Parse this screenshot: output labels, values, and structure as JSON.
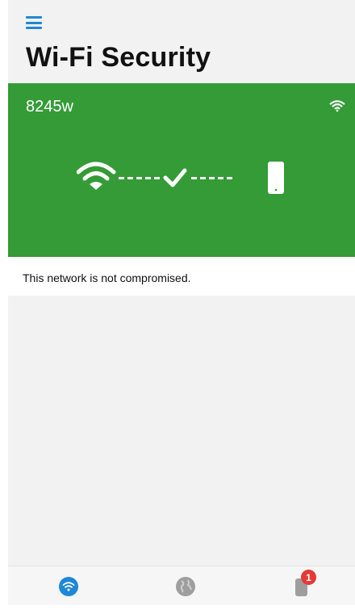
{
  "header": {
    "title": "Wi-Fi Security"
  },
  "network": {
    "ssid": "8245w",
    "status_text": "This network is not compromised.",
    "banner_color": "#349b37"
  },
  "tabbar": {
    "tabs": [
      {
        "icon": "wifi-icon",
        "active": true,
        "color": "#1e88d6"
      },
      {
        "icon": "globe-icon",
        "active": false,
        "color": "#9e9e9e"
      },
      {
        "icon": "device-icon",
        "active": false,
        "color": "#9e9e9e",
        "badge": "1"
      }
    ]
  },
  "colors": {
    "accent": "#1e88d6",
    "badge": "#e53935"
  }
}
